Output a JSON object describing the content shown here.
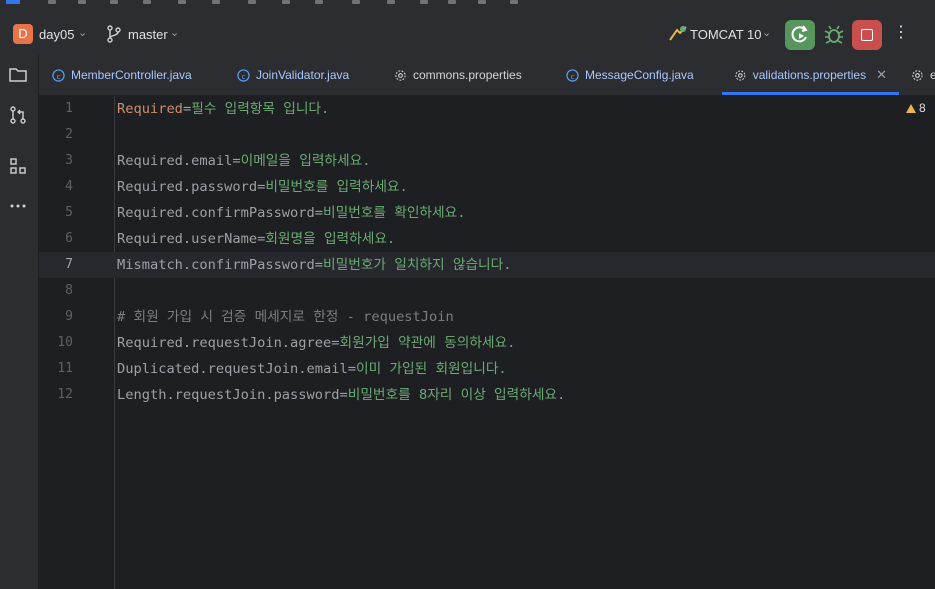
{
  "toolbar": {
    "project_badge": "D",
    "project_name": "day05",
    "branch": "master",
    "run_config": "TOMCAT 10"
  },
  "tabs": [
    {
      "label": "MemberController.java",
      "icon": "class-icon"
    },
    {
      "label": "JoinValidator.java",
      "icon": "class-icon"
    },
    {
      "label": "commons.properties",
      "icon": "gear-icon"
    },
    {
      "label": "MessageConfig.java",
      "icon": "class-icon"
    },
    {
      "label": "validations.properties",
      "icon": "gear-icon",
      "active": true
    },
    {
      "label": "e",
      "icon": "gear-icon"
    }
  ],
  "editor": {
    "warning_count": "8",
    "current_line": 7,
    "lines": [
      {
        "num": "1",
        "key": "Required",
        "eq": "=",
        "val": "필수 입력항목 입니다."
      },
      {
        "num": "2",
        "key": "",
        "eq": "",
        "val": ""
      },
      {
        "num": "3",
        "key": "Required.email",
        "eq": "=",
        "val": "이메일을 입력하세요."
      },
      {
        "num": "4",
        "key": "Required.password",
        "eq": "=",
        "val": "비밀번호를 입력하세요."
      },
      {
        "num": "5",
        "key": "Required.confirmPassword",
        "eq": "=",
        "val": "비밀번호를 확인하세요."
      },
      {
        "num": "6",
        "key": "Required.userName",
        "eq": "=",
        "val": "회원명을 입력하세요."
      },
      {
        "num": "7",
        "key": "Mismatch.confirmPassword",
        "eq": "=",
        "val": "비밀번호가 일치하지 않습니다."
      },
      {
        "num": "8",
        "key": "",
        "eq": "",
        "val": ""
      },
      {
        "num": "9",
        "comment": "# 회원 가입 시 검증 메세지로 한정 - requestJoin"
      },
      {
        "num": "10",
        "key": "Required.requestJoin.agree",
        "eq": "=",
        "val": "회원가입 약관에 동의하세요."
      },
      {
        "num": "11",
        "key": "Duplicated.requestJoin.email",
        "eq": "=",
        "val": "이미 가입된 회원입니다."
      },
      {
        "num": "12",
        "key": "Length.requestJoin.password",
        "eq": "=",
        "val": "비밀번호를 8자리 이상 입력하세요."
      }
    ]
  }
}
